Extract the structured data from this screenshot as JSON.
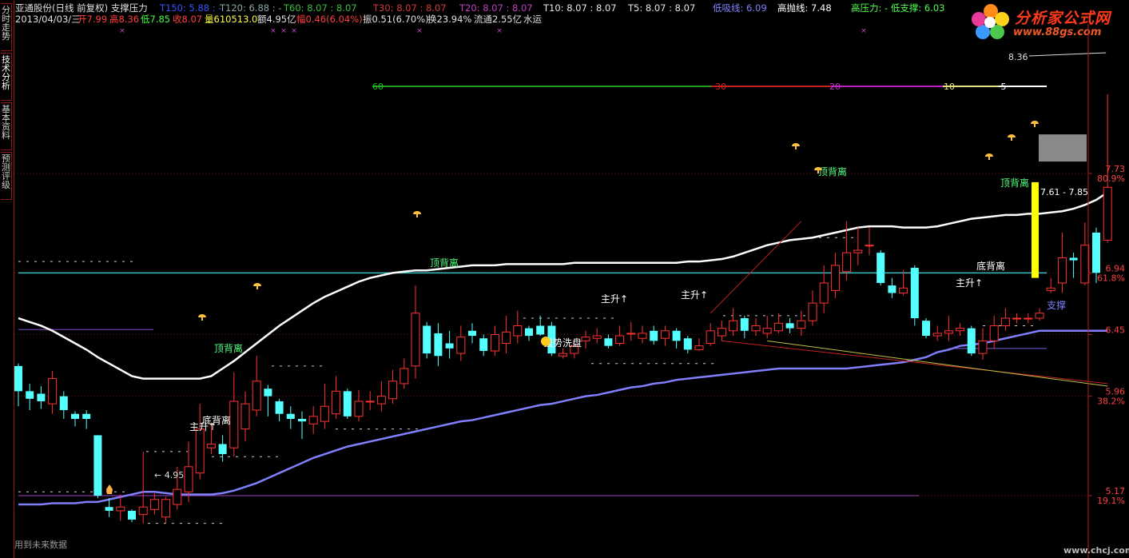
{
  "sidebar": {
    "tabs": [
      {
        "label": "分时走势",
        "active": false
      },
      {
        "label": "技术分析",
        "active": true
      },
      {
        "label": "基本资料",
        "active": false
      },
      {
        "label": "预测评级",
        "active": false
      }
    ]
  },
  "header": {
    "stock": "亚通股份(日线 前复权) 支撑压力",
    "t150": "T150: 5.88 : -",
    "t120": "T120: 6.88 : -",
    "t60": "T60: 8.07 : 8.07",
    "t30": "T30: 8.07 : 8.07",
    "t20": "T20: 8.07 : 8.07",
    "t10": "T10: 8.07 : 8.07",
    "t5": "T5: 8.07 : 8.07",
    "low_buy": "低吸线: 6.09",
    "high_sell": "高抛线: 7.48",
    "pressure_support": "高压力: - 低支撑: 6.03",
    "date": "2013/04/03/三",
    "open": "开7.99",
    "high": "高8.36",
    "low": "低7.85",
    "close": "收8.07",
    "volume": "量610513.0",
    "amount": "额4.95亿",
    "change": "幅0.46(6.04%)",
    "amplitude": "振0.51(6.70%)",
    "turnover": "换23.94%",
    "float_cap": "流通2.55亿",
    "sector": "水运"
  },
  "logo": {
    "text": "分析家公式网",
    "url": "www.88gs.com"
  },
  "footer_note": "用到未来数据",
  "watermark": "www.chcj.com",
  "colors": {
    "up": "#ff3232",
    "down": "#54ffff",
    "white_line": "#ffffff",
    "purple_line": "#8080ff",
    "cyan_line": "#38c0c0",
    "axis": "#b02020",
    "yellow": "#ffff00"
  },
  "chart_data": {
    "type": "candlestick",
    "ylim": [
      4.77,
      8.6
    ],
    "y_axis_ticks": [
      {
        "price": "7.73",
        "pct": "80.9%"
      },
      {
        "price": "6.94",
        "pct": "61.8%"
      },
      {
        "price": "6.45",
        "pct": ""
      },
      {
        "price": "5.96",
        "pct": "38.2%"
      },
      {
        "price": "5.17",
        "pct": "19.1%"
      }
    ],
    "candles": [
      [
        6.2,
        6.0,
        6.22,
        5.88
      ],
      [
        6.0,
        5.94,
        6.06,
        5.85
      ],
      [
        5.98,
        5.92,
        6.04,
        5.86
      ],
      [
        5.9,
        6.1,
        6.16,
        5.82
      ],
      [
        5.96,
        5.85,
        6.0,
        5.78
      ],
      [
        5.82,
        5.78,
        5.84,
        5.72
      ],
      [
        5.82,
        5.78,
        5.85,
        5.7
      ],
      [
        5.65,
        5.17,
        5.65,
        5.15
      ],
      [
        5.08,
        5.05,
        5.15,
        5.0
      ],
      [
        5.05,
        5.08,
        5.18,
        4.97
      ],
      [
        5.05,
        4.98,
        5.06,
        4.96
      ],
      [
        5.02,
        5.08,
        5.52,
        4.95
      ],
      [
        5.06,
        5.14,
        5.19,
        5.02
      ],
      [
        5.0,
        5.14,
        5.16,
        4.95
      ],
      [
        5.1,
        5.22,
        5.4,
        5.06
      ],
      [
        5.2,
        5.4,
        5.6,
        5.12
      ],
      [
        5.35,
        5.7,
        5.9,
        5.3
      ],
      [
        5.55,
        5.58,
        5.75,
        5.5
      ],
      [
        5.58,
        5.5,
        5.65,
        5.44
      ],
      [
        5.55,
        5.92,
        6.15,
        5.48
      ],
      [
        5.7,
        5.9,
        6.0,
        5.6
      ],
      [
        5.85,
        6.08,
        6.28,
        5.8
      ],
      [
        6.02,
        5.96,
        6.05,
        5.8
      ],
      [
        5.92,
        5.82,
        5.94,
        5.76
      ],
      [
        5.82,
        5.78,
        5.88,
        5.7
      ],
      [
        5.78,
        5.76,
        5.84,
        5.62
      ],
      [
        5.74,
        5.8,
        5.88,
        5.66
      ],
      [
        5.76,
        5.88,
        6.06,
        5.7
      ],
      [
        5.82,
        6.0,
        6.12,
        5.78
      ],
      [
        6.0,
        5.8,
        6.02,
        5.78
      ],
      [
        5.8,
        5.92,
        6.01,
        5.76
      ],
      [
        5.92,
        5.92,
        6.0,
        5.85
      ],
      [
        5.9,
        5.96,
        6.08,
        5.84
      ],
      [
        5.94,
        6.08,
        6.17,
        5.9
      ],
      [
        6.06,
        6.18,
        6.26,
        6.02
      ],
      [
        6.2,
        6.62,
        6.84,
        6.1
      ],
      [
        6.52,
        6.3,
        6.55,
        6.26
      ],
      [
        6.46,
        6.28,
        6.54,
        6.2
      ],
      [
        6.38,
        6.34,
        6.48,
        6.26
      ],
      [
        6.3,
        6.43,
        6.52,
        6.24
      ],
      [
        6.48,
        6.44,
        6.54,
        6.38
      ],
      [
        6.42,
        6.32,
        6.45,
        6.28
      ],
      [
        6.32,
        6.45,
        6.52,
        6.28
      ],
      [
        6.38,
        6.47,
        6.6,
        6.3
      ],
      [
        6.44,
        6.52,
        6.64,
        6.38
      ],
      [
        6.5,
        6.44,
        6.52,
        6.4
      ],
      [
        6.52,
        6.45,
        6.6,
        6.44
      ],
      [
        6.52,
        6.3,
        6.55,
        6.28
      ],
      [
        6.28,
        6.3,
        6.34,
        6.26
      ],
      [
        6.3,
        6.36,
        6.42,
        6.26
      ],
      [
        6.4,
        6.43,
        6.48,
        6.34
      ],
      [
        6.42,
        6.44,
        6.5,
        6.38
      ],
      [
        6.42,
        6.36,
        6.45,
        6.34
      ],
      [
        6.38,
        6.44,
        6.52,
        6.36
      ],
      [
        6.46,
        6.46,
        6.55,
        6.4
      ],
      [
        6.42,
        6.46,
        6.52,
        6.38
      ],
      [
        6.48,
        6.4,
        6.52,
        6.37
      ],
      [
        6.42,
        6.48,
        6.52,
        6.36
      ],
      [
        6.48,
        6.4,
        6.5,
        6.34
      ],
      [
        6.42,
        6.33,
        6.44,
        6.3
      ],
      [
        6.33,
        6.36,
        6.42,
        6.32
      ],
      [
        6.38,
        6.48,
        6.54,
        6.36
      ],
      [
        6.44,
        6.5,
        6.56,
        6.4
      ],
      [
        6.48,
        6.56,
        6.66,
        6.44
      ],
      [
        6.58,
        6.48,
        6.6,
        6.42
      ],
      [
        6.48,
        6.52,
        6.58,
        6.44
      ],
      [
        6.46,
        6.5,
        6.6,
        6.42
      ],
      [
        6.48,
        6.54,
        6.62,
        6.46
      ],
      [
        6.54,
        6.5,
        6.58,
        6.46
      ],
      [
        6.5,
        6.56,
        6.64,
        6.44
      ],
      [
        6.56,
        6.7,
        6.8,
        6.52
      ],
      [
        6.7,
        6.86,
        7.0,
        6.62
      ],
      [
        6.8,
        7.0,
        7.1,
        6.74
      ],
      [
        6.95,
        7.1,
        7.35,
        6.88
      ],
      [
        7.1,
        7.12,
        7.3,
        7.0
      ],
      [
        7.16,
        7.16,
        7.3,
        7.08
      ],
      [
        7.1,
        6.86,
        7.12,
        6.84
      ],
      [
        6.84,
        6.78,
        6.9,
        6.74
      ],
      [
        6.78,
        6.82,
        6.96,
        6.76
      ],
      [
        6.98,
        6.58,
        7.0,
        6.52
      ],
      [
        6.56,
        6.44,
        6.58,
        6.42
      ],
      [
        6.44,
        6.46,
        6.52,
        6.4
      ],
      [
        6.46,
        6.48,
        6.6,
        6.4
      ],
      [
        6.48,
        6.5,
        6.54,
        6.44
      ],
      [
        6.5,
        6.3,
        6.52,
        6.28
      ],
      [
        6.3,
        6.4,
        6.5,
        6.25
      ],
      [
        6.4,
        6.52,
        6.6,
        6.34
      ],
      [
        6.52,
        6.58,
        6.66,
        6.48
      ],
      [
        6.58,
        6.58,
        6.62,
        6.54
      ],
      [
        6.58,
        6.58,
        6.62,
        6.54
      ],
      [
        6.58,
        6.62,
        6.66,
        6.56
      ],
      [
        6.8,
        6.82,
        6.9,
        6.78
      ],
      [
        6.86,
        7.06,
        7.26,
        6.78
      ],
      [
        7.06,
        7.04,
        7.1,
        6.9
      ],
      [
        6.86,
        7.16,
        7.34,
        6.84
      ],
      [
        7.26,
        6.94,
        7.3,
        6.86
      ],
      [
        7.2,
        7.62,
        8.36,
        7.18
      ]
    ],
    "ma_white": [
      6.58,
      6.55,
      6.52,
      6.48,
      6.43,
      6.38,
      6.33,
      6.27,
      6.22,
      6.17,
      6.12,
      6.1,
      6.1,
      6.1,
      6.1,
      6.1,
      6.1,
      6.12,
      6.18,
      6.24,
      6.31,
      6.38,
      6.45,
      6.52,
      6.58,
      6.64,
      6.7,
      6.75,
      6.79,
      6.83,
      6.87,
      6.9,
      6.92,
      6.94,
      6.95,
      6.96,
      6.96,
      6.97,
      6.98,
      6.99,
      7.0,
      7.0,
      7.0,
      7.01,
      7.01,
      7.01,
      7.01,
      7.01,
      7.01,
      7.02,
      7.02,
      7.02,
      7.02,
      7.02,
      7.02,
      7.02,
      7.02,
      7.02,
      7.02,
      7.03,
      7.03,
      7.04,
      7.05,
      7.07,
      7.1,
      7.13,
      7.16,
      7.18,
      7.2,
      7.21,
      7.22,
      7.24,
      7.26,
      7.28,
      7.3,
      7.31,
      7.31,
      7.31,
      7.3,
      7.3,
      7.3,
      7.31,
      7.33,
      7.35,
      7.37,
      7.38,
      7.39,
      7.4,
      7.4,
      7.41,
      7.41,
      7.42,
      7.43,
      7.45,
      7.48,
      7.52,
      7.58
    ],
    "ma_purple": [
      5.1,
      5.1,
      5.1,
      5.11,
      5.11,
      5.11,
      5.12,
      5.12,
      5.14,
      5.16,
      5.18,
      5.2,
      5.2,
      5.19,
      5.18,
      5.18,
      5.18,
      5.18,
      5.19,
      5.21,
      5.24,
      5.27,
      5.31,
      5.35,
      5.39,
      5.43,
      5.47,
      5.5,
      5.53,
      5.56,
      5.58,
      5.6,
      5.62,
      5.64,
      5.66,
      5.68,
      5.7,
      5.72,
      5.74,
      5.76,
      5.77,
      5.79,
      5.81,
      5.83,
      5.85,
      5.87,
      5.89,
      5.9,
      5.92,
      5.94,
      5.96,
      5.97,
      5.99,
      6.01,
      6.03,
      6.04,
      6.06,
      6.07,
      6.09,
      6.1,
      6.11,
      6.12,
      6.13,
      6.14,
      6.15,
      6.16,
      6.17,
      6.18,
      6.18,
      6.18,
      6.18,
      6.18,
      6.18,
      6.18,
      6.19,
      6.2,
      6.21,
      6.22,
      6.23,
      6.25,
      6.27,
      6.31,
      6.33,
      6.36,
      6.37,
      6.38,
      6.4,
      6.42,
      6.44,
      6.46,
      6.48,
      6.48,
      6.48,
      6.48,
      6.48,
      6.48,
      6.48
    ],
    "cyan_level": 6.94,
    "magenta_level": 5.17,
    "left_purple_level": 6.49,
    "label_values": {
      "top_price": "8.36",
      "low_price": "4.95",
      "range_box": "7.61 - 7.85"
    },
    "countdown_labels": [
      "60",
      "30",
      "20",
      "10",
      "5"
    ],
    "annotations": {
      "top_div": "顶背离",
      "bottom_div": "底背离",
      "main_rise": "主升",
      "wash": "强势洗盘",
      "support": "支撑"
    }
  }
}
